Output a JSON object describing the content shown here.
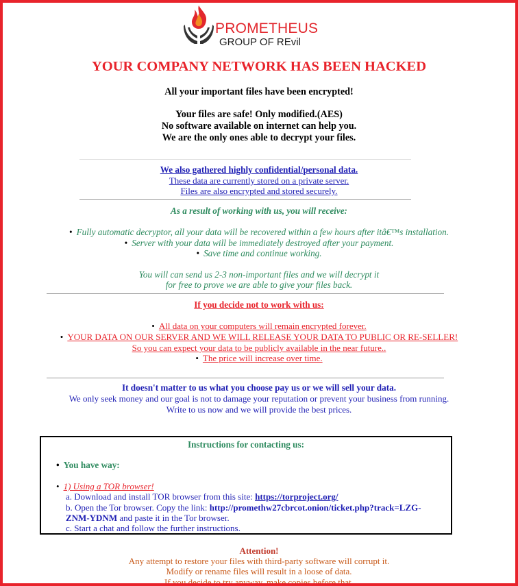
{
  "brand": {
    "name": "PROMETHEUS",
    "sub": "GROUP OF REvil"
  },
  "title": "YOUR COMPANY NETWORK HAS BEEN HACKED",
  "intro": [
    "All your important files have been encrypted!",
    "Your files are safe! Only modified.(AES)",
    "No software available on internet can help you.",
    "We are the only ones able to decrypt your files."
  ],
  "data_notice": [
    "We also gathered highly confidential/personal data.",
    "These data are currently stored on a private server.",
    "Files are also encrypted and stored securely."
  ],
  "receive": {
    "heading": "As a result of working with us, you will receive:",
    "items": [
      "Fully automatic decryptor, all your data will be recovered within a few hours after itâ€™s installation.",
      "Server with your data will be immediately destroyed after your payment.",
      "Save time and continue working."
    ],
    "note": [
      "You will can send us 2-3 non-important files and we will decrypt it",
      "for free to prove we are able to give your files back."
    ]
  },
  "not_work": {
    "heading": "If you decide not to work with us:",
    "items": [
      "All data on your computers will remain encrypted forever.",
      "YOUR DATA ON OUR SERVER AND WE WILL RELEASE YOUR DATA TO PUBLIC OR RE-SELLER!",
      "So you can expect your data to be publicly available in the near future..",
      "The price will increase over time."
    ]
  },
  "closing": [
    "It doesn't matter to us what you choose pay us or we will sell your data.",
    "We only seek money and our goal is not to damage your reputation or prevent your business from running.",
    "Write to us now and we will provide the best prices."
  ],
  "instructions": {
    "title": "Instructions for contacting us:",
    "way": "You have way:",
    "option": "1) Using a TOR browser!",
    "step_a": "a. Download and install TOR browser from this site: ",
    "tor_url": "https://torproject.org/",
    "step_b1": "b. Open the Tor browser. Copy the link: ",
    "link_part1": "http://promethw27cbrcot.onion/ticket.php?track=LZG-",
    "link_part2": "ZNM-YDNM",
    "step_b2": " and paste it in the Tor browser.",
    "step_c": "c. Start a chat and follow the further instructions."
  },
  "attention": {
    "heading": "Attention!",
    "lines": [
      "Any attempt to restore your files with third-party software will corrupt it.",
      "Modify or rename files will result in a loose of data.",
      "If you decide to try anyway, make copies before that."
    ]
  },
  "colors": {
    "border": "#e8232b",
    "blue": "#1f1fb4",
    "green": "#2d8a5e",
    "orange": "#c85a1a"
  }
}
